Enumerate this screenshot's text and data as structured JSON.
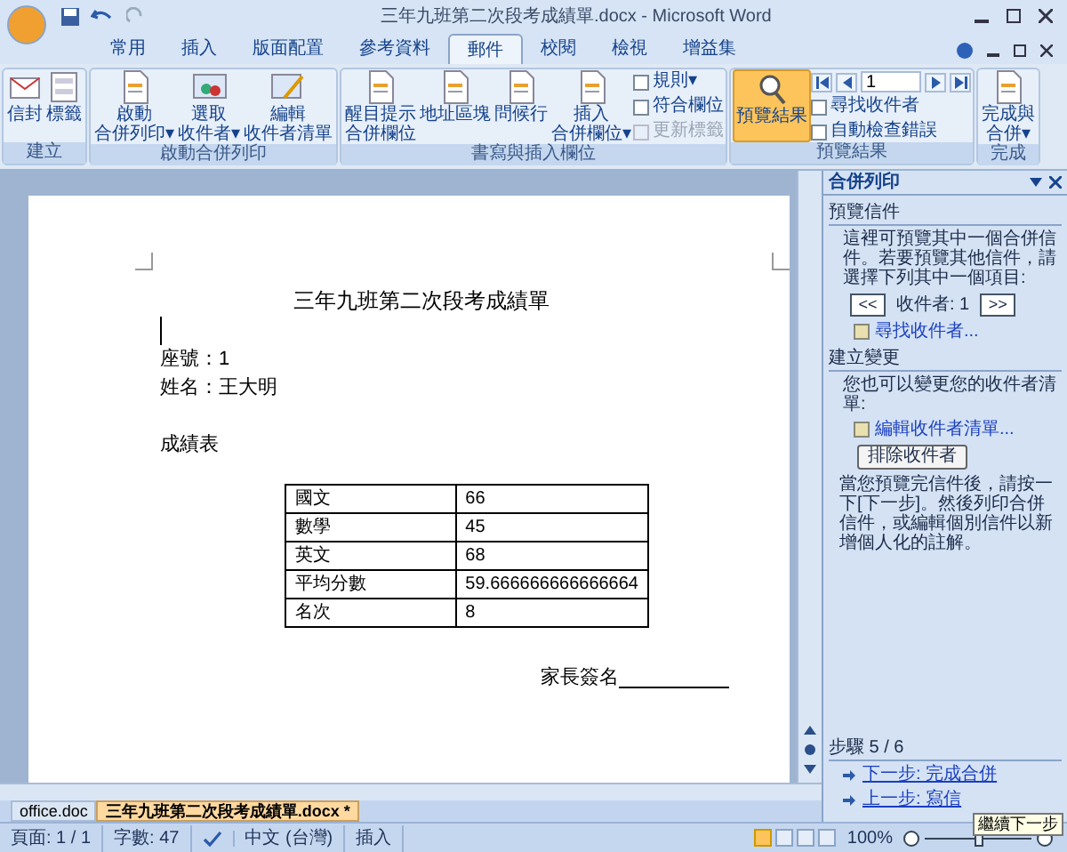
{
  "window": {
    "title": "三年九班第二次段考成績單.docx - Microsoft Word"
  },
  "tabs": [
    {
      "label": "常用",
      "selected": false
    },
    {
      "label": "插入",
      "selected": false
    },
    {
      "label": "版面配置",
      "selected": false
    },
    {
      "label": "參考資料",
      "selected": false
    },
    {
      "label": "郵件",
      "selected": true
    },
    {
      "label": "校閱",
      "selected": false
    },
    {
      "label": "檢視",
      "selected": false
    },
    {
      "label": "增益集",
      "selected": false
    }
  ],
  "ribbon": [
    {
      "name": "建立",
      "items": [
        {
          "kind": "big",
          "lines": [
            "信封"
          ]
        },
        {
          "kind": "big",
          "lines": [
            "標籤"
          ]
        }
      ]
    },
    {
      "name": "啟動合併列印",
      "items": [
        {
          "kind": "big",
          "lines": [
            "啟動",
            "合併列印▾"
          ]
        },
        {
          "kind": "big",
          "lines": [
            "選取",
            "收件者▾"
          ]
        },
        {
          "kind": "big",
          "lines": [
            "編輯",
            "收件者清單"
          ]
        }
      ]
    },
    {
      "name": "書寫與插入欄位",
      "items": [
        {
          "kind": "big",
          "lines": [
            "醒目提示",
            "合併欄位"
          ]
        },
        {
          "kind": "big",
          "lines": [
            "地址區塊"
          ]
        },
        {
          "kind": "big",
          "lines": [
            "問候行"
          ]
        },
        {
          "kind": "big",
          "lines": [
            "插入",
            "合併欄位▾"
          ]
        },
        {
          "kind": "stack",
          "rows": [
            {
              "label": "規則▾",
              "disabled": false
            },
            {
              "label": "符合欄位",
              "disabled": false
            },
            {
              "label": "更新標籤",
              "disabled": true
            }
          ]
        }
      ]
    },
    {
      "name": "預覽結果",
      "items": [
        {
          "kind": "big",
          "lines": [
            "預覽結果"
          ],
          "selected": true
        },
        {
          "kind": "nav",
          "record": "1",
          "rows": [
            {
              "label": "尋找收件者",
              "disabled": false
            },
            {
              "label": "自動檢查錯誤",
              "disabled": false
            }
          ]
        }
      ]
    },
    {
      "name": "完成",
      "items": [
        {
          "kind": "big",
          "lines": [
            "完成與",
            "合併▾"
          ]
        }
      ]
    }
  ],
  "document": {
    "title": "三年九班第二次段考成績單",
    "lines": [
      "座號：1",
      "姓名：王大明",
      "成績表"
    ],
    "table": [
      [
        "國文",
        "66"
      ],
      [
        "數學",
        "45"
      ],
      [
        "英文",
        "68"
      ],
      [
        "平均分數",
        "59.666666666666664"
      ],
      [
        "名次",
        "8"
      ]
    ],
    "signature": "家長簽名"
  },
  "task_pane": {
    "title": "合併列印",
    "sections": [
      {
        "heading": "預覽信件",
        "text": "這裡可預覽其中一個合併信件。若要預覽其他信件，請選擇下列其中一個項目:",
        "prev": "<<",
        "recipient": "收件者: 1",
        "next": ">>",
        "link": "尋找收件者..."
      },
      {
        "heading": "建立變更",
        "text": "您也可以變更您的收件者清單:",
        "link": "編輯收件者清單...",
        "button": "排除收件者",
        "note": "當您預覽完信件後，請按一下[下一步]。然後列印合併信件，或編輯個別信件以新增個人化的註解。"
      }
    ],
    "step": "步驟 5 / 6",
    "next_link": "下一步: 完成合併",
    "prev_link": "上一步: 寫信",
    "tooltip": "繼續下一步"
  },
  "doc_tabs": [
    {
      "label": "office.doc",
      "selected": false
    },
    {
      "label": "三年九班第二次段考成績單.docx *",
      "selected": true
    }
  ],
  "status_bar": {
    "page": "頁面: 1 / 1",
    "words": "字數: 47",
    "language": "中文 (台灣)",
    "mode": "插入",
    "zoom": "100%",
    "zoom_slider": {
      "level": 0.5
    }
  }
}
